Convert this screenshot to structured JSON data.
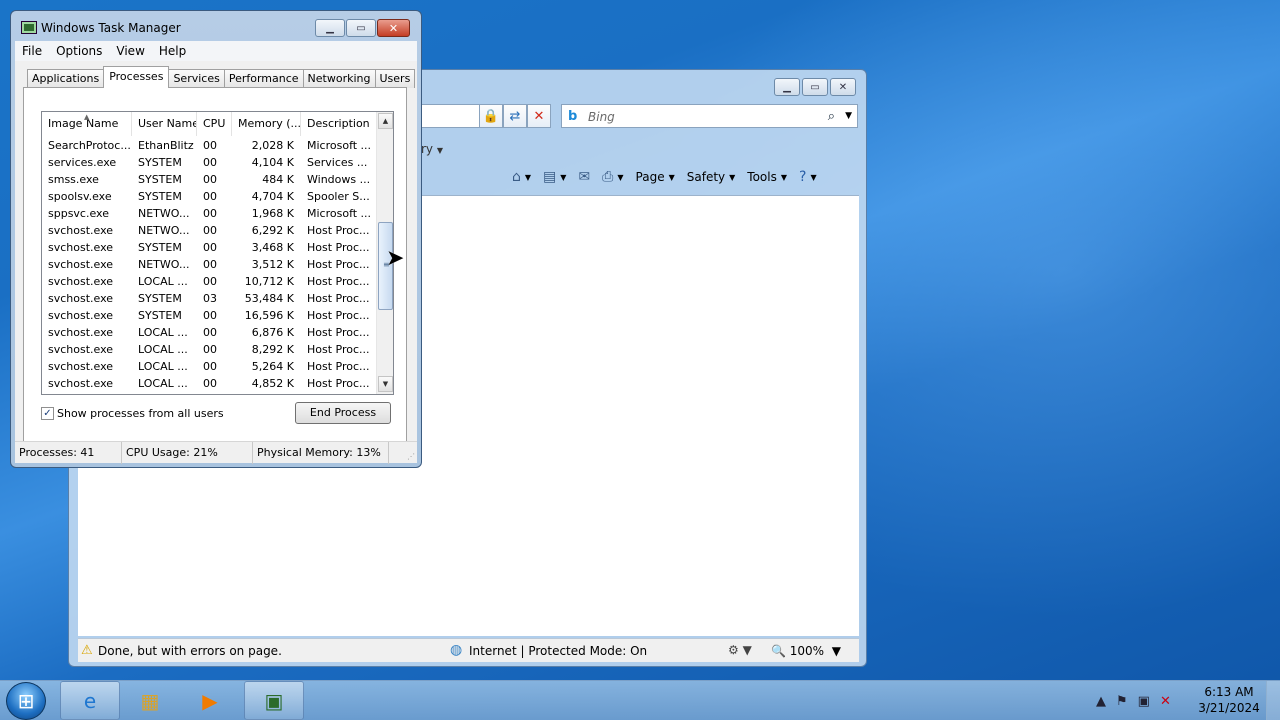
{
  "ie": {
    "search_placeholder": "Bing",
    "favorites_fragment": "ry",
    "commands": {
      "page": "Page",
      "safety": "Safety",
      "tools": "Tools"
    },
    "status_text": "Done, but with errors on page.",
    "zone_text": "Internet | Protected Mode: On",
    "zoom_text": "100%"
  },
  "taskmgr": {
    "title": "Windows Task Manager",
    "menu": [
      "File",
      "Options",
      "View",
      "Help"
    ],
    "tabs": [
      "Applications",
      "Processes",
      "Services",
      "Performance",
      "Networking",
      "Users"
    ],
    "active_tab": "Processes",
    "columns": [
      "Image Name",
      "User Name",
      "CPU",
      "Memory (...",
      "Description"
    ],
    "rows": [
      {
        "image": "SearchProtoc...",
        "user": "EthanBlitz",
        "cpu": "00",
        "mem": "2,028 K",
        "desc": "Microsoft ..."
      },
      {
        "image": "services.exe",
        "user": "SYSTEM",
        "cpu": "00",
        "mem": "4,104 K",
        "desc": "Services ..."
      },
      {
        "image": "smss.exe",
        "user": "SYSTEM",
        "cpu": "00",
        "mem": "484 K",
        "desc": "Windows ..."
      },
      {
        "image": "spoolsv.exe",
        "user": "SYSTEM",
        "cpu": "00",
        "mem": "4,704 K",
        "desc": "Spooler S..."
      },
      {
        "image": "sppsvc.exe",
        "user": "NETWO...",
        "cpu": "00",
        "mem": "1,968 K",
        "desc": "Microsoft ..."
      },
      {
        "image": "svchost.exe",
        "user": "NETWO...",
        "cpu": "00",
        "mem": "6,292 K",
        "desc": "Host Proc..."
      },
      {
        "image": "svchost.exe",
        "user": "SYSTEM",
        "cpu": "00",
        "mem": "3,468 K",
        "desc": "Host Proc..."
      },
      {
        "image": "svchost.exe",
        "user": "NETWO...",
        "cpu": "00",
        "mem": "3,512 K",
        "desc": "Host Proc..."
      },
      {
        "image": "svchost.exe",
        "user": "LOCAL ...",
        "cpu": "00",
        "mem": "10,712 K",
        "desc": "Host Proc..."
      },
      {
        "image": "svchost.exe",
        "user": "SYSTEM",
        "cpu": "03",
        "mem": "53,484 K",
        "desc": "Host Proc..."
      },
      {
        "image": "svchost.exe",
        "user": "SYSTEM",
        "cpu": "00",
        "mem": "16,596 K",
        "desc": "Host Proc..."
      },
      {
        "image": "svchost.exe",
        "user": "LOCAL ...",
        "cpu": "00",
        "mem": "6,876 K",
        "desc": "Host Proc..."
      },
      {
        "image": "svchost.exe",
        "user": "LOCAL ...",
        "cpu": "00",
        "mem": "8,292 K",
        "desc": "Host Proc..."
      },
      {
        "image": "svchost.exe",
        "user": "LOCAL ...",
        "cpu": "00",
        "mem": "5,264 K",
        "desc": "Host Proc..."
      },
      {
        "image": "svchost.exe",
        "user": "LOCAL ...",
        "cpu": "00",
        "mem": "4,852 K",
        "desc": "Host Proc..."
      }
    ],
    "show_all_label": "Show processes from all users",
    "show_all_checked": true,
    "end_process_label": "End Process",
    "status": {
      "processes": "Processes: 41",
      "cpu": "CPU Usage: 21%",
      "memory": "Physical Memory: 13%"
    }
  },
  "taskbar": {
    "clock_time": "6:13 AM",
    "clock_date": "3/21/2024"
  }
}
